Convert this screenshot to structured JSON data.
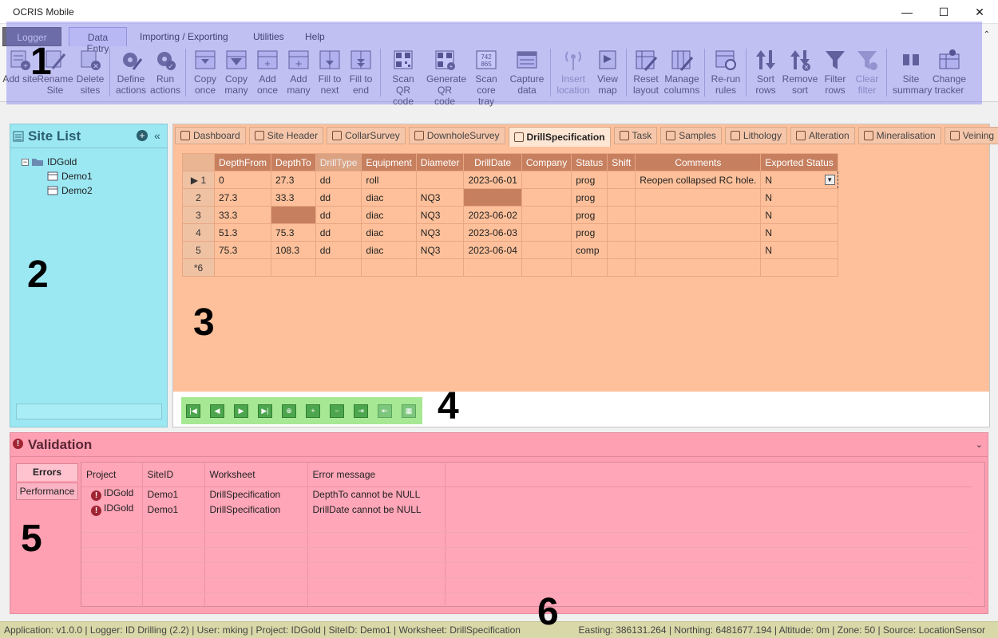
{
  "window": {
    "title": "OCRIS Mobile",
    "minimize": "—",
    "maximize": "☐",
    "close": "✕"
  },
  "ribbon": {
    "tabs": [
      "Logger",
      "Data Entry",
      "Importing / Exporting",
      "Utilities",
      "Help"
    ],
    "collapse_icon": "chevron-up-icon",
    "buttons": [
      {
        "label": "Add site",
        "icon": "add-site-icon"
      },
      {
        "label": "Rename Site",
        "icon": "rename-icon"
      },
      {
        "label": "Delete sites",
        "icon": "delete-sites-icon"
      },
      {
        "label": "Define actions",
        "icon": "gear-edit-icon"
      },
      {
        "label": "Run actions",
        "icon": "gear-run-icon"
      },
      {
        "label": "Copy once",
        "icon": "copy-once-icon"
      },
      {
        "label": "Copy many",
        "icon": "copy-many-icon"
      },
      {
        "label": "Add once",
        "icon": "add-once-icon"
      },
      {
        "label": "Add many",
        "icon": "add-many-icon"
      },
      {
        "label": "Fill to next",
        "icon": "fill-next-icon"
      },
      {
        "label": "Fill to end",
        "icon": "fill-end-icon"
      },
      {
        "label": "Scan QR code",
        "icon": "qr-scan-icon"
      },
      {
        "label": "Generate QR code",
        "icon": "qr-generate-icon"
      },
      {
        "label": "Scan core tray",
        "icon": "core-tray-icon"
      },
      {
        "label": "Capture data",
        "icon": "capture-icon"
      },
      {
        "label": "Insert location",
        "icon": "antenna-icon",
        "disabled": true
      },
      {
        "label": "View map",
        "icon": "map-flag-icon"
      },
      {
        "label": "Reset layout",
        "icon": "reset-layout-icon"
      },
      {
        "label": "Manage columns",
        "icon": "columns-icon"
      },
      {
        "label": "Re-run rules",
        "icon": "rerun-rules-icon"
      },
      {
        "label": "Sort rows",
        "icon": "sort-icon"
      },
      {
        "label": "Remove sort",
        "icon": "remove-sort-icon"
      },
      {
        "label": "Filter rows",
        "icon": "filter-icon"
      },
      {
        "label": "Clear filter",
        "icon": "clear-filter-icon",
        "disabled": true
      },
      {
        "label": "Site summary",
        "icon": "summary-icon"
      },
      {
        "label": "Change tracker",
        "icon": "tracker-icon"
      }
    ]
  },
  "annotations": [
    "1",
    "2",
    "3",
    "4",
    "5",
    "6"
  ],
  "site_list": {
    "title": "Site List",
    "add_icon": "plus-circle-icon",
    "collapse": "«",
    "tree": {
      "project": "IDGold",
      "sites": [
        "Demo1",
        "Demo2"
      ]
    }
  },
  "worksheet_tabs": [
    {
      "label": "Dashboard",
      "icon": "dashboard-icon"
    },
    {
      "label": "Site Header",
      "icon": "briefcase-icon"
    },
    {
      "label": "CollarSurvey",
      "icon": "survey-icon"
    },
    {
      "label": "DownholeSurvey",
      "icon": "downhole-icon"
    },
    {
      "label": "DrillSpecification",
      "icon": "drill-spec-icon",
      "active": true
    },
    {
      "label": "Task",
      "icon": "task-icon"
    },
    {
      "label": "Samples",
      "icon": "samples-icon"
    },
    {
      "label": "Lithology",
      "icon": "lithology-icon"
    },
    {
      "label": "Alteration",
      "icon": "alteration-icon"
    },
    {
      "label": "Mineralisation",
      "icon": "dollar-icon"
    },
    {
      "label": "Veining",
      "icon": "veining-icon"
    }
  ],
  "grid": {
    "columns": [
      "DepthFrom",
      "DepthTo",
      "DrillType",
      "Equipment",
      "Diameter",
      "DrillDate",
      "Company",
      "Status",
      "Shift",
      "Comments",
      "Exported Status"
    ],
    "rows": [
      {
        "n": "1",
        "cells": [
          "0",
          "27.3",
          "dd",
          "roll",
          "",
          "2023-06-01",
          "",
          "prog",
          "",
          "Reopen collapsed RC hole.",
          "N"
        ]
      },
      {
        "n": "2",
        "cells": [
          "27.3",
          "33.3",
          "dd",
          "diac",
          "NQ3",
          "",
          "",
          "prog",
          "",
          "",
          "N"
        ]
      },
      {
        "n": "3",
        "cells": [
          "33.3",
          "",
          "dd",
          "diac",
          "NQ3",
          "2023-06-02",
          "",
          "prog",
          "",
          "",
          "N"
        ]
      },
      {
        "n": "4",
        "cells": [
          "51.3",
          "75.3",
          "dd",
          "diac",
          "NQ3",
          "2023-06-03",
          "",
          "prog",
          "",
          "",
          "N"
        ]
      },
      {
        "n": "5",
        "cells": [
          "75.3",
          "108.3",
          "dd",
          "diac",
          "NQ3",
          "2023-06-04",
          "",
          "comp",
          "",
          "",
          "N"
        ]
      }
    ],
    "new_row": "*6",
    "current_marker": "▶"
  },
  "navigator": [
    "first-record-icon",
    "prev-record-icon",
    "next-record-icon",
    "last-record-icon",
    "add-copy-icon",
    "add-record-icon",
    "delete-record-icon",
    "export-icon",
    "import-icon",
    "grid-export-icon"
  ],
  "validation": {
    "title": "Validation",
    "tabs": [
      "Errors",
      "Performance"
    ],
    "columns": [
      "Project",
      "SiteID",
      "Worksheet",
      "Error message"
    ],
    "rows": [
      {
        "project": "IDGold",
        "site": "Demo1",
        "worksheet": "DrillSpecification",
        "message": "DepthTo cannot be NULL"
      },
      {
        "project": "IDGold",
        "site": "Demo1",
        "worksheet": "DrillSpecification",
        "message": "DrillDate cannot be NULL"
      }
    ]
  },
  "status_bar": {
    "left": "Application: v1.0.0 | Logger: ID Drilling (2.2) | User: mking | Project: IDGold | SiteID: Demo1 | Worksheet: DrillSpecification",
    "right": "Easting: 386131.264 | Northing: 6481677.194 | Altitude: 0m | Zone: 50 | Source: LocationSensor"
  },
  "colors": {
    "ribbon_overlay": "#7070f0",
    "site_panel": "#9be8f3",
    "grid_area": "#fec09a",
    "navigator": "#a7e894",
    "validation": "#fe9fb2",
    "status": "#d8d8a8"
  }
}
